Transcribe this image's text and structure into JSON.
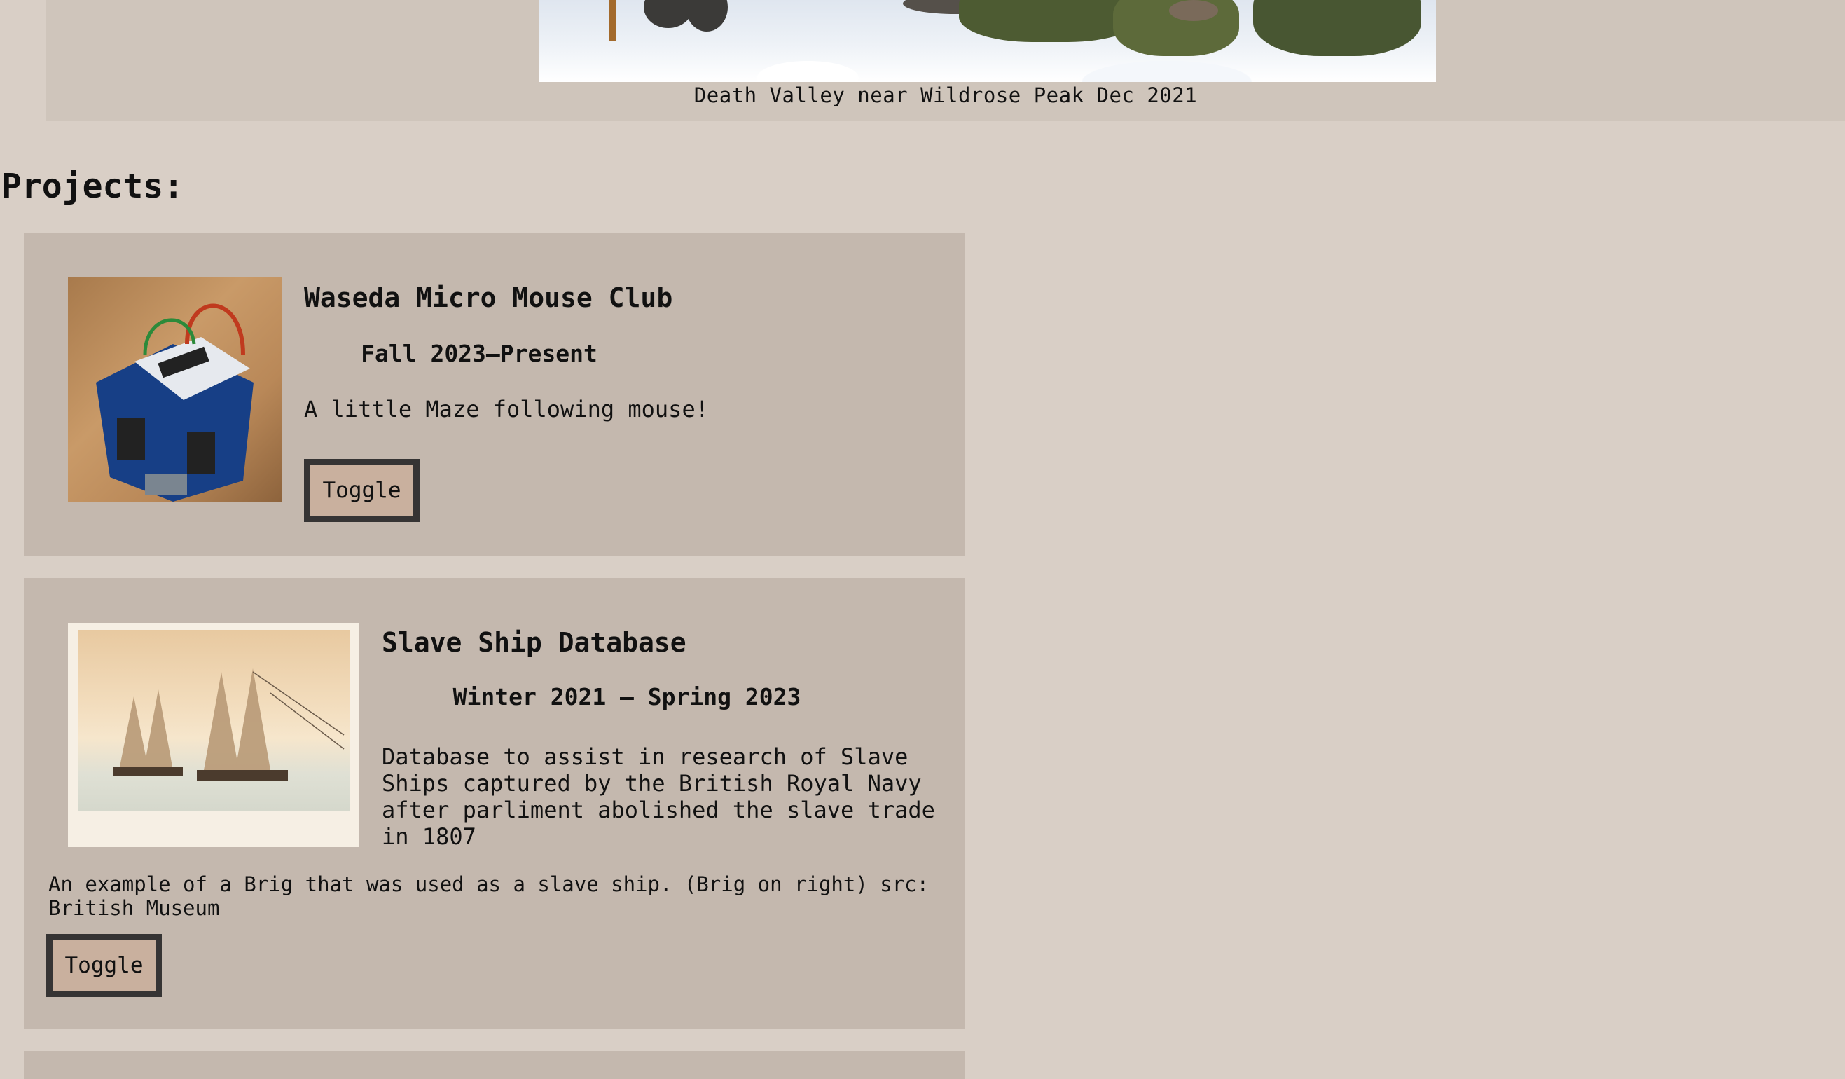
{
  "hero": {
    "caption": "Death Valley near Wildrose Peak Dec 2021"
  },
  "projects": {
    "heading": "Projects:",
    "items": [
      {
        "title": "Waseda Micro Mouse Club",
        "dates": "Fall 2023–Present",
        "description": "A little Maze following mouse!",
        "toggle_label": "Toggle"
      },
      {
        "title": "Slave Ship Database",
        "dates": "Winter 2021 – Spring 2023",
        "description_lines": [
          "Database to assist in research of Slave",
          "Ships captured by the British Royal Navy",
          "after parliment abolished the slave trade",
          "in 1807"
        ],
        "image_caption_lines": [
          "An example of a Brig that was used as a slave ship. (Brig on right) src:",
          "British Museum"
        ],
        "toggle_label": "Toggle"
      }
    ]
  },
  "colors": {
    "page_background": "#d9cfc6",
    "card_background": "#c4b8ae",
    "button_background": "#c9b09e",
    "button_border": "#363434"
  }
}
